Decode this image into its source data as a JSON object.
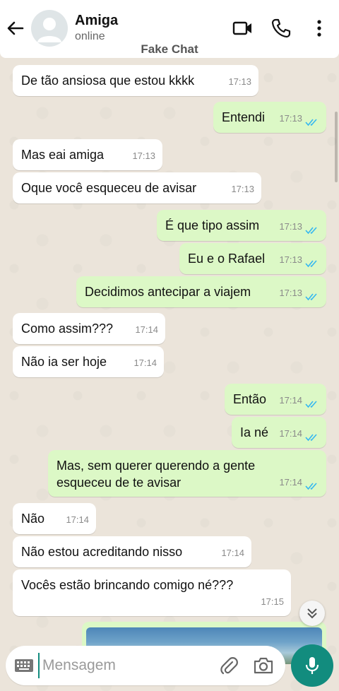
{
  "header": {
    "contact_name": "Amiga",
    "status": "online",
    "watermark": "Fake Chat"
  },
  "messages": [
    {
      "dir": "in",
      "text": "De tão ansiosa que estou kkkk",
      "time": "17:13"
    },
    {
      "dir": "out",
      "text": "Entendi",
      "time": "17:13",
      "read": true
    },
    {
      "dir": "in",
      "text": "Mas eai amiga",
      "time": "17:13"
    },
    {
      "dir": "in",
      "text": "Oque você esqueceu de avisar",
      "time": "17:13"
    },
    {
      "dir": "out",
      "text": "É que tipo assim",
      "time": "17:13",
      "read": true
    },
    {
      "dir": "out",
      "text": "Eu e o Rafael",
      "time": "17:13",
      "read": true
    },
    {
      "dir": "out",
      "text": "Decidimos antecipar a viajem",
      "time": "17:13",
      "read": true
    },
    {
      "dir": "in",
      "text": "Como assim???",
      "time": "17:14"
    },
    {
      "dir": "in",
      "text": "Não ia ser hoje",
      "time": "17:14"
    },
    {
      "dir": "out",
      "text": "Então",
      "time": "17:14",
      "read": true
    },
    {
      "dir": "out",
      "text": "Ia né",
      "time": "17:14",
      "read": true
    },
    {
      "dir": "out",
      "text": "Mas, sem querer querendo a gente esqueceu de te avisar",
      "time": "17:14",
      "read": true
    },
    {
      "dir": "in",
      "text": "Não",
      "time": "17:14"
    },
    {
      "dir": "in",
      "text": "Não estou acreditando nisso",
      "time": "17:14"
    },
    {
      "dir": "in",
      "text": "Vocês estão brincando comigo né???",
      "time": "17:15"
    }
  ],
  "composer": {
    "placeholder": "Mensagem"
  },
  "colors": {
    "incoming_bubble": "#ffffff",
    "outgoing_bubble": "#dcf8c6",
    "accent": "#128c7e",
    "read_ticks": "#34b7f1",
    "wallpaper": "#ece5dd"
  },
  "icons": {
    "back": "arrow-left-icon",
    "video": "video-camera-icon",
    "call": "phone-icon",
    "menu": "more-vert-icon",
    "scroll_down": "chevron-double-down-icon",
    "keyboard": "keyboard-icon",
    "attach": "paperclip-icon",
    "camera": "camera-icon",
    "mic": "microphone-icon"
  }
}
